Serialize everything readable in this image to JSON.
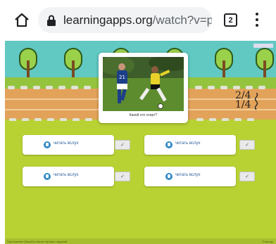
{
  "browser": {
    "url_main": "learningapps.org",
    "url_rest": "/watch?v=p",
    "tab_count": "2"
  },
  "app": {
    "question": "Какой это спорт?",
    "fraction_top": "2/4",
    "fraction_bottom": "1/4",
    "answers": [
      {
        "label": "читать вслух",
        "check": "✓"
      },
      {
        "label": "читать вслух",
        "check": "✓"
      },
      {
        "label": "читать вслух",
        "check": "✓"
      },
      {
        "label": "читать вслух",
        "check": "✓"
      }
    ],
    "footer_left": "Приложение [Какой] в банке игровых заданий",
    "footer_right": "Помощь",
    "colors": {
      "sky": "#61c8c2",
      "grass": "#b8d233",
      "track": "#e3a25a",
      "speaker": "#2f89c9"
    }
  }
}
